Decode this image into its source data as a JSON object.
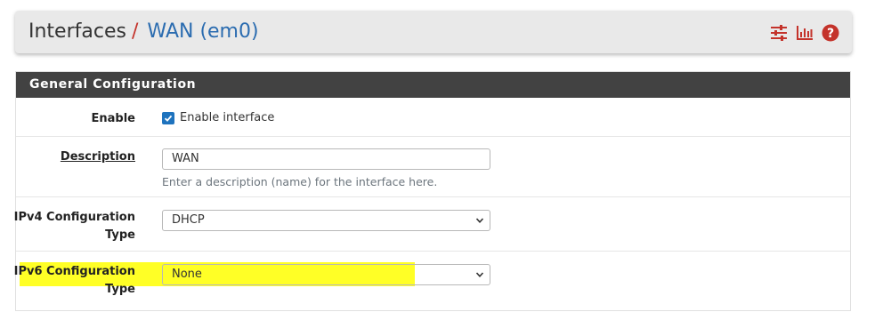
{
  "breadcrumb": {
    "root": "Interfaces",
    "separator": "/",
    "current": "WAN (em0)"
  },
  "header_icons": [
    "sliders-icon",
    "bar-chart-icon",
    "help-icon"
  ],
  "panel": {
    "title": "General Configuration"
  },
  "form": {
    "enable": {
      "label": "Enable",
      "checkbox_label": "Enable interface",
      "checked": true
    },
    "description": {
      "label": "Description",
      "value": "WAN",
      "help": "Enter a description (name) for the interface here."
    },
    "ipv4_type": {
      "label_line1": "IPv4 Configuration",
      "label_line2": "Type",
      "selected": "DHCP"
    },
    "ipv6_type": {
      "label_line1": "IPv6 Configuration",
      "label_line2": "Type",
      "selected": "None"
    }
  },
  "colors": {
    "heading_bg": "#424242",
    "accent_red": "#c4332b",
    "link_blue": "#2b6cb0",
    "highlight": "#ffff26"
  }
}
